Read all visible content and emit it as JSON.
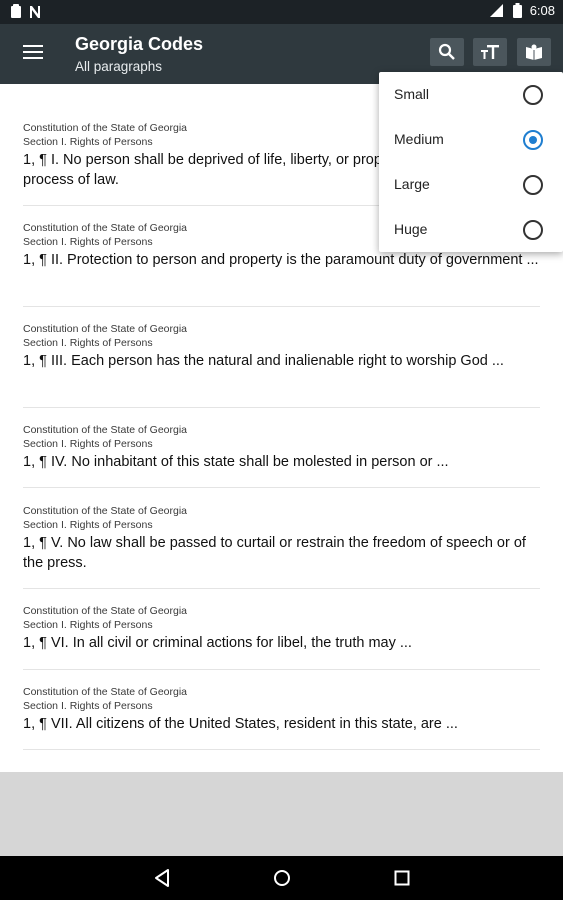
{
  "status_bar": {
    "time": "6:08",
    "left_icons": [
      "clipboard-icon",
      "n-notification-icon"
    ],
    "right_icons": [
      "signal-icon",
      "battery-icon"
    ]
  },
  "app_bar": {
    "title": "Georgia Codes",
    "subtitle": "All paragraphs",
    "actions": [
      "search-icon",
      "text-size-icon",
      "book-icon"
    ]
  },
  "paragraphs": [
    {
      "source": "Constitution of the State of Georgia",
      "section": "Section I. Rights of Persons",
      "text": "1, ¶ I. No person shall be deprived of life, liberty, or property except by due process of law."
    },
    {
      "source": "Constitution of the State of Georgia",
      "section": "Section I. Rights of Persons",
      "text": "1, ¶ II. Protection to person and property is the paramount duty of government ..."
    },
    {
      "source": "Constitution of the State of Georgia",
      "section": "Section I. Rights of Persons",
      "text": "1, ¶ III. Each person has the natural and inalienable right to worship God ..."
    },
    {
      "source": "Constitution of the State of Georgia",
      "section": "Section I. Rights of Persons",
      "text": "1, ¶ IV. No inhabitant of this state shall be molested in person or ..."
    },
    {
      "source": "Constitution of the State of Georgia",
      "section": "Section I. Rights of Persons",
      "text": "1, ¶ V. No law shall be passed to curtail or restrain the freedom of speech or of the press."
    },
    {
      "source": "Constitution of the State of Georgia",
      "section": "Section I. Rights of Persons",
      "text": "1, ¶ VI. In all civil or criminal actions for libel, the truth may ..."
    },
    {
      "source": "Constitution of the State of Georgia",
      "section": "Section I. Rights of Persons",
      "text": "1, ¶ VII. All citizens of the United States, resident in this state, are ..."
    }
  ],
  "text_size_menu": {
    "options": [
      {
        "label": "Small",
        "selected": false
      },
      {
        "label": "Medium",
        "selected": true
      },
      {
        "label": "Large",
        "selected": false
      },
      {
        "label": "Huge",
        "selected": false
      }
    ],
    "accent_color": "#1f7ed0"
  },
  "colors": {
    "app_bar": "#2f393e",
    "status_bar": "#1c2226",
    "action_button": "#4b565c"
  },
  "nav_bar": {
    "buttons": [
      "back-icon",
      "home-icon",
      "recents-icon"
    ]
  }
}
